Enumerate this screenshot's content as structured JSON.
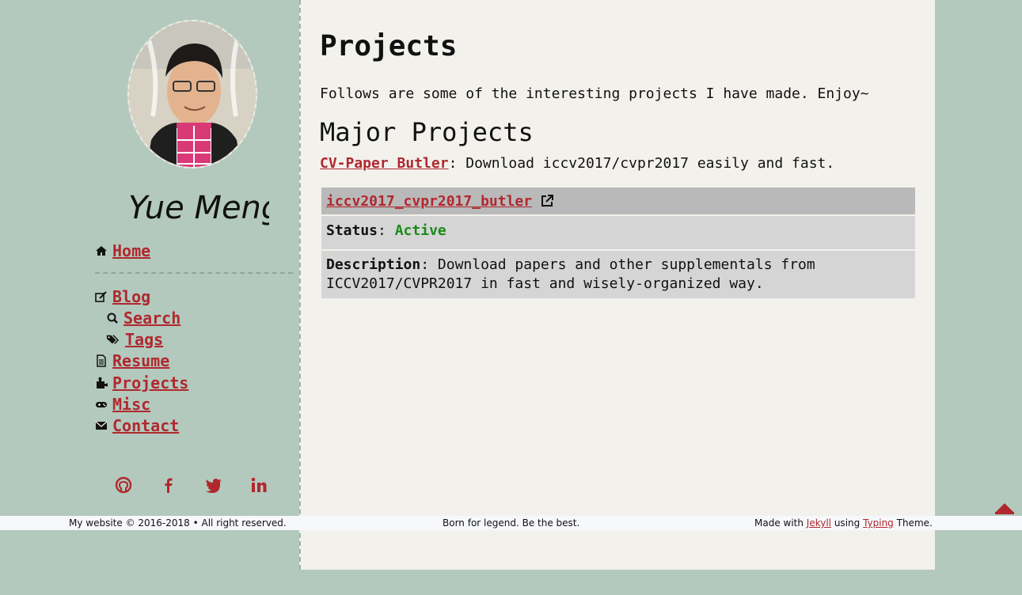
{
  "sidebar": {
    "name_signature": "Yue Meng",
    "nav": [
      {
        "label": "Home",
        "icon": "home-icon"
      },
      {
        "label": "Blog",
        "icon": "edit-icon"
      },
      {
        "label": "Search",
        "icon": "search-icon"
      },
      {
        "label": "Tags",
        "icon": "tags-icon"
      },
      {
        "label": "Resume",
        "icon": "file-icon"
      },
      {
        "label": "Projects",
        "icon": "puzzle-icon"
      },
      {
        "label": "Misc",
        "icon": "gamepad-icon"
      },
      {
        "label": "Contact",
        "icon": "envelope-icon"
      }
    ],
    "social": [
      "github-icon",
      "facebook-icon",
      "twitter-icon",
      "linkedin-icon"
    ]
  },
  "main": {
    "title": "Projects",
    "intro": "Follows are some of the interesting projects I have made. Enjoy~",
    "section_title": "Major Projects",
    "project": {
      "link_label": "CV-Paper Butler",
      "summary": ": Download iccv2017/cvpr2017 easily and fast.",
      "repo_name": "iccv2017_cvpr2017_butler",
      "status_label": "Status",
      "status_value": "Active",
      "description_label": "Description",
      "description": ": Download papers and other supplementals from ICCV2017/CVPR2017 in fast and wisely-organized way."
    }
  },
  "footer": {
    "left": "My website © 2016-2018 • All right reserved.",
    "center": "Born for legend. Be the best.",
    "right_prefix": "Made with ",
    "right_link1": "Jekyll",
    "right_mid": " using ",
    "right_link2": "Typing",
    "right_suffix": " Theme."
  },
  "colors": {
    "accent": "#b0282e",
    "sidebar_bg": "#b3c9be",
    "main_bg": "#f3f1ec",
    "status_active": "#1a8a1a"
  }
}
